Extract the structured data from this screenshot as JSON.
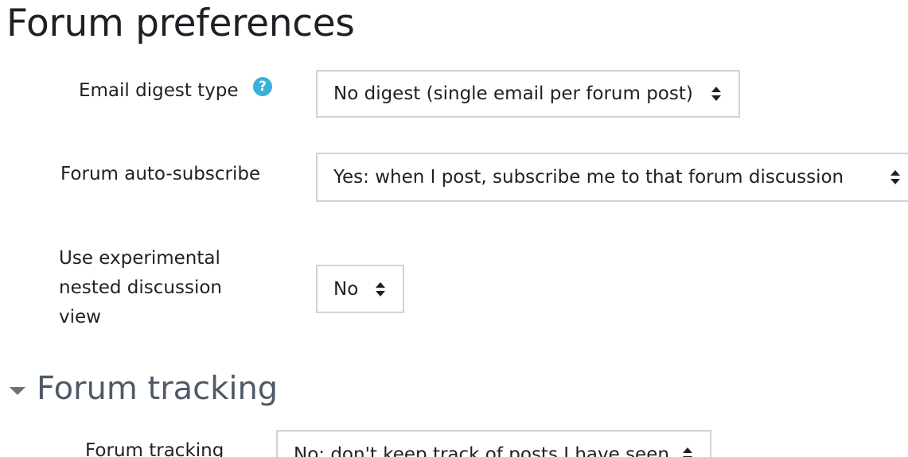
{
  "page": {
    "title": "Forum preferences"
  },
  "fields": {
    "email_digest": {
      "label": "Email digest type",
      "help_icon": "question-circle-icon",
      "value": "No digest (single email per forum post)"
    },
    "auto_subscribe": {
      "label": "Forum auto-subscribe",
      "value": "Yes: when I post, subscribe me to that forum discussion"
    },
    "nested_view": {
      "label_lines": [
        "Use experimental",
        "nested discussion",
        "view"
      ],
      "value": "No"
    }
  },
  "section_tracking": {
    "toggle_icon": "caret-down-icon",
    "title": "Forum tracking",
    "field": {
      "label": "Forum tracking",
      "value": "No: don't keep track of posts I have seen"
    }
  },
  "colors": {
    "help_icon": "#3bb0d8",
    "section_title": "#4e5a66",
    "select_border": "#cfd3d7"
  }
}
